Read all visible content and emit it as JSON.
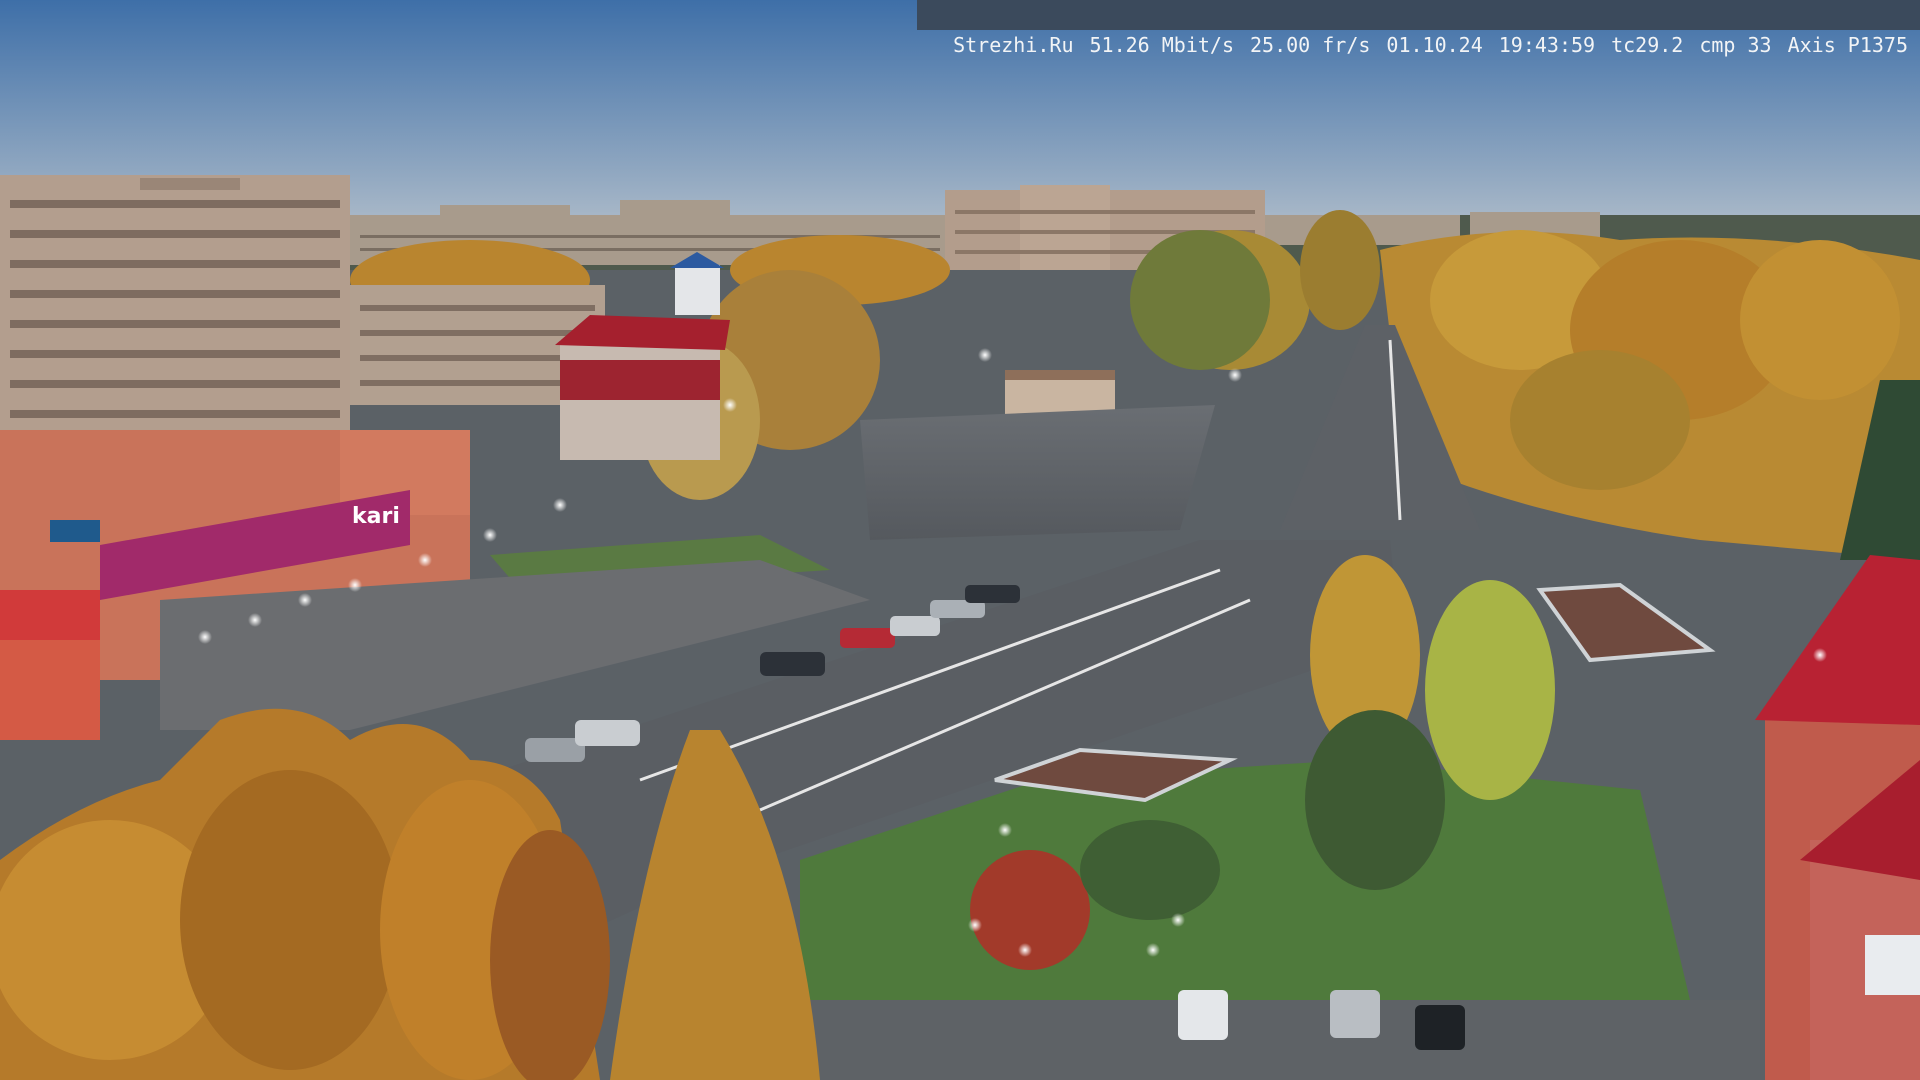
{
  "overlay": {
    "site": "Strezhi.Ru",
    "bitrate": "51.26 Mbit/s",
    "framerate": "25.00 fr/s",
    "date": "01.10.24",
    "time": "19:43:59",
    "tc": "tc29.2",
    "cmp": "cmp 33",
    "camera": "Axis P1375"
  },
  "signs": {
    "store_name": "kari"
  },
  "colors": {
    "sky_top": "#3e6fa8",
    "sky_bottom": "#a9b7c6",
    "road": "#5e6369",
    "autumn_trees": "#c88a2a",
    "brand_magenta": "#b0286a",
    "roof_red": "#b81e30"
  }
}
